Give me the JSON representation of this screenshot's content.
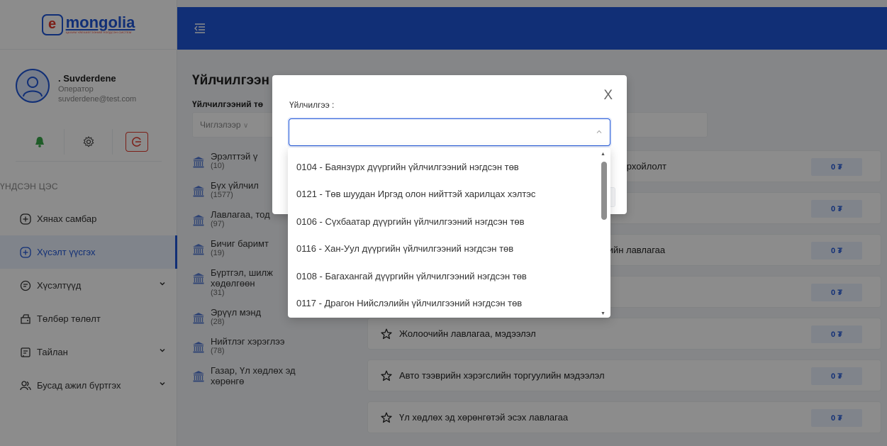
{
  "brand": {
    "name": "mongolia",
    "e_letter": "e",
    "subtitle": "ЦАХИМ ҮЙЛЧИЛГЭЭНИЙ НЭГДСЭН СИСТЕМ"
  },
  "user": {
    "name": ". Suvderdene",
    "role": "Оператор",
    "email": "suvderdene@test.com"
  },
  "sidebar": {
    "menu_heading": "ҮНДСЭН ЦЭС",
    "items": [
      {
        "label": "Хянах самбар",
        "icon": "plus-circle-icon",
        "active": false,
        "has_chevron": false
      },
      {
        "label": "Хүсэлт үүсгэх",
        "icon": "plus-circle-icon",
        "active": true,
        "has_chevron": false
      },
      {
        "label": "Хүсэлтүүд",
        "icon": "request-icon",
        "active": false,
        "has_chevron": true
      },
      {
        "label": "Төлбөр төлөлт",
        "icon": "wallet-icon",
        "active": false,
        "has_chevron": false
      },
      {
        "label": "Тайлан",
        "icon": "report-icon",
        "active": false,
        "has_chevron": true
      },
      {
        "label": "Бусад ажил бүртгэх",
        "icon": "users-icon",
        "active": false,
        "has_chevron": true
      }
    ]
  },
  "main": {
    "title": "Үйлчилгээн",
    "type_label": "Үйлчилгээний тө",
    "type_select_placeholder": "Чиглэлээр",
    "categories": [
      {
        "name": "Эрэлттэй ү",
        "count": "(10)"
      },
      {
        "name": "Бүх үйлчил",
        "count": "(1577)"
      },
      {
        "name": "Лавлагаа, тод",
        "count": "(97)"
      },
      {
        "name": "Бичиг баримт",
        "count": "(19)"
      },
      {
        "name": "Бүртгэл, шилж",
        "name2": "хөдөлгөөн",
        "count": "(31)"
      },
      {
        "name": "Эрүүл мэнд",
        "count": "(28)"
      },
      {
        "name": "Нийтлэг хэрэглээ",
        "count": "(78)"
      },
      {
        "name": "Газар, Үл хөдлөх эд",
        "name2": "хөрөнгө",
        "count": ""
      }
    ],
    "services": [
      {
        "name": "ох тодорхойлолт",
        "price": "0 ₮",
        "show_star": false
      },
      {
        "name": "",
        "price": "0 ₮",
        "show_star": false
      },
      {
        "name": "гэлийн лавлагаа",
        "price": "0 ₮",
        "show_star": false
      },
      {
        "name": "",
        "price": "0 ₮",
        "show_star": false
      },
      {
        "name": "Жолоочийн лавлагаа, мэдээлэл",
        "price": "0 ₮",
        "show_star": true
      },
      {
        "name": "Авто тээврийн хэрэгслийн торгуулийн мэдээлэл",
        "price": "0 ₮",
        "show_star": true
      },
      {
        "name": "Үл хөдлөх эд хөрөнгөтэй эсэх лавлагаа",
        "price": "0 ₮",
        "show_star": true
      }
    ]
  },
  "modal": {
    "field_label": "Үйлчилгээ :",
    "close_symbol": "X",
    "input_value": "",
    "options": [
      "0104 - Баянзүрх дүүргийн үйлчилгээний нэгдсэн төв",
      "0121 - Төв шуудан Иргэд олон нийттэй харилцах хэлтэс",
      "0106 - Сүхбаатар дүүргийн үйлчилгээний нэгдсэн төв",
      "0116 - Хан-Уул дүүргийн үйлчилгээний нэгдсэн төв",
      "0108 - Багахангай дүүргийн үйлчилгээний нэгдсэн төв",
      "0117 - Драгон Нийслэлийн үйлчилгээний нэгдсэн төв"
    ]
  },
  "colors": {
    "primary": "#1f56d8",
    "danger": "#e23a2c",
    "bell": "#3aa849"
  }
}
